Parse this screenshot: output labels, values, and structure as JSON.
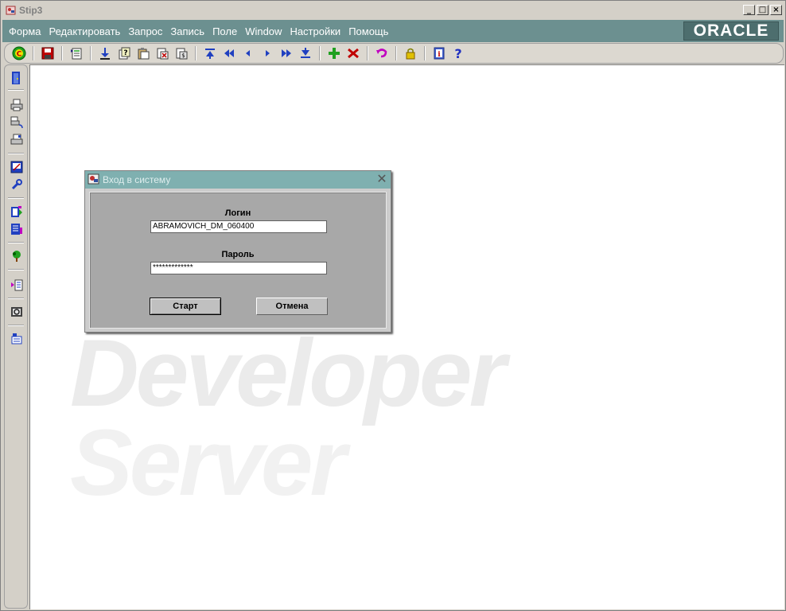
{
  "window": {
    "title": "Stip3",
    "minimize": "_",
    "maximize": "□",
    "close": "×"
  },
  "menubar": {
    "items": [
      "Форма",
      "Редактировать",
      "Запрос",
      "Запись",
      "Поле",
      "Window",
      "Настройки",
      "Помощь"
    ],
    "logo": "ORACLE"
  },
  "watermark": {
    "line1": "Developer",
    "line2": "Server"
  },
  "dialog": {
    "title": "Вход в систему",
    "login_label": "Логин",
    "login_value": "ABRAMOVICH_DM_060400",
    "password_label": "Пароль",
    "password_value": "*************",
    "start_label": "Старт",
    "cancel_label": "Отмена",
    "close_glyph": "✕"
  },
  "colors": {
    "menubar_bg": "#6c9090",
    "dialog_title_bg": "#7fb0b0",
    "dialog_body_bg": "#a8a8a8"
  }
}
